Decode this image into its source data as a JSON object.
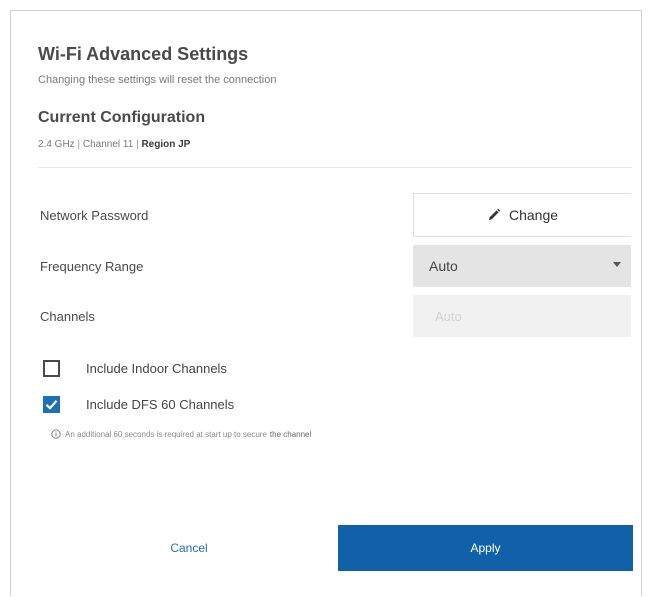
{
  "dialog": {
    "title": "Wi-Fi Advanced Settings",
    "subtitle": "Changing these settings will reset the connection"
  },
  "config": {
    "heading": "Current Configuration",
    "band": "2.4 GHz",
    "separator": "|",
    "channel": "Channel 11",
    "region": "Region JP"
  },
  "rows": {
    "network_password": {
      "label": "Network Password",
      "button_label": "Change",
      "button_icon": "pencil-icon"
    },
    "frequency_range": {
      "label": "Frequency Range",
      "value": "Auto",
      "icon": "caret-down-icon"
    },
    "channels": {
      "label": "Channels",
      "value": "Auto"
    }
  },
  "options": {
    "indoor": {
      "label": "Include Indoor Channels",
      "checked": false
    },
    "dfs": {
      "label": "Include DFS 60 Channels",
      "checked": true
    }
  },
  "info": {
    "icon": "info-icon",
    "text": "An additional 60 seconds is required at start up to secure",
    "emphasis": "the channel"
  },
  "actions": {
    "cancel_label": "Cancel",
    "apply_label": "Apply"
  },
  "colors": {
    "accent": "#1161a8",
    "link": "#1e6fb4",
    "select_bg": "#e4e4e4"
  }
}
